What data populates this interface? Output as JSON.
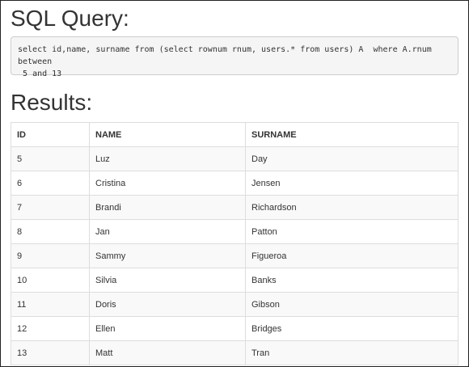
{
  "query_section": {
    "heading": "SQL Query:",
    "sql": "select id,name, surname from (select rownum rnum, users.* from users) A  where A.rnum between\n 5 and 13"
  },
  "results_section": {
    "heading": "Results:",
    "columns": [
      "ID",
      "NAME",
      "SURNAME"
    ],
    "rows": [
      [
        "5",
        "Luz",
        "Day"
      ],
      [
        "6",
        "Cristina",
        "Jensen"
      ],
      [
        "7",
        "Brandi",
        "Richardson"
      ],
      [
        "8",
        "Jan",
        "Patton"
      ],
      [
        "9",
        "Sammy",
        "Figueroa"
      ],
      [
        "10",
        "Silvia",
        "Banks"
      ],
      [
        "11",
        "Doris",
        "Gibson"
      ],
      [
        "12",
        "Ellen",
        "Bridges"
      ],
      [
        "13",
        "Matt",
        "Tran"
      ]
    ]
  }
}
